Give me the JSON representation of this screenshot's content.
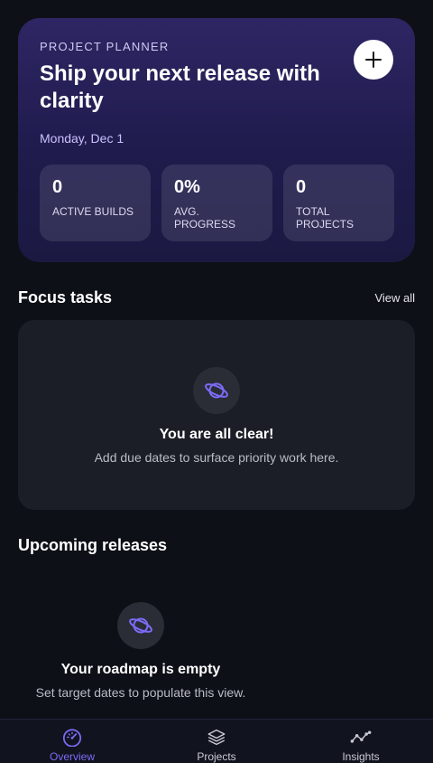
{
  "hero": {
    "eyebrow": "PROJECT PLANNER",
    "title": "Ship your next release with clarity",
    "date": "Monday, Dec 1",
    "add_icon": "plus-icon",
    "stats": [
      {
        "value": "0",
        "label": "ACTIVE BUILDS"
      },
      {
        "value": "0%",
        "label": "AVG. PROGRESS"
      },
      {
        "value": "0",
        "label": "TOTAL PROJECTS"
      }
    ]
  },
  "focus": {
    "title": "Focus tasks",
    "view_all": "View all",
    "empty_icon": "planet-icon",
    "empty_title": "You are all clear!",
    "empty_sub": "Add due dates to surface priority work here."
  },
  "releases": {
    "title": "Upcoming releases",
    "empty_icon": "planet-icon",
    "empty_title": "Your roadmap is empty",
    "empty_sub": "Set target dates to populate this view."
  },
  "nav": {
    "items": [
      {
        "label": "Overview",
        "icon": "speedometer-icon",
        "active": true
      },
      {
        "label": "Projects",
        "icon": "layers-icon",
        "active": false
      },
      {
        "label": "Insights",
        "icon": "line-chart-icon",
        "active": false
      }
    ]
  },
  "colors": {
    "accent": "#7b6cf6",
    "background": "#0e1017",
    "card": "#1c1e27"
  }
}
